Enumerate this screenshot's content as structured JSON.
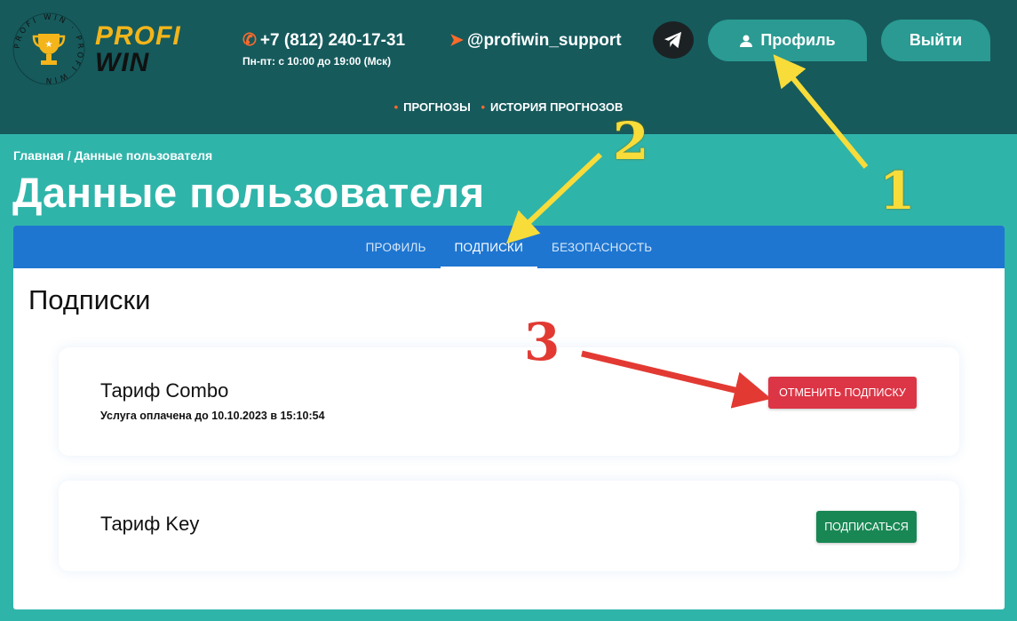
{
  "logo": {
    "ring_text": "PROFI WIN · PROFI WIN",
    "line1": "PROFI",
    "line2": "WIN"
  },
  "contacts": {
    "phone": "+7 (812) 240-17-31",
    "hours": "Пн-пт: с 10:00 до 19:00 (Мск)",
    "telegram": "@profiwin_support"
  },
  "header_buttons": {
    "profile": "Профиль",
    "logout": "Выйти"
  },
  "topnav": {
    "items": [
      "ПРОГНОЗЫ",
      "ИСТОРИЯ ПРОГНОЗОВ"
    ]
  },
  "breadcrumb": "Главная / Данные пользователя",
  "page_title": "Данные пользователя",
  "tabs": [
    {
      "label": "ПРОФИЛЬ",
      "active": false
    },
    {
      "label": "ПОДПИСКИ",
      "active": true
    },
    {
      "label": "БЕЗОПАСНОСТЬ",
      "active": false
    }
  ],
  "section_title": "Подписки",
  "subscriptions": [
    {
      "name": "Тариф Combo",
      "paid_until": "Услуга оплачена до 10.10.2023 в 15:10:54",
      "action": "ОТМЕНИТЬ ПОДПИСКУ"
    },
    {
      "name": "Тариф Key",
      "action": "ПОДПИСАТЬСЯ"
    }
  ],
  "annotations": [
    "1",
    "2",
    "3"
  ],
  "colors": {
    "header": "#165a5c",
    "background": "#2fb4aa",
    "tabs": "#1e76d1",
    "accent": "#f3b51a",
    "cancel": "#dc3545",
    "subscribe": "#198754",
    "arrow_yellow": "#f7dc3a",
    "arrow_red": "#e23a33"
  }
}
